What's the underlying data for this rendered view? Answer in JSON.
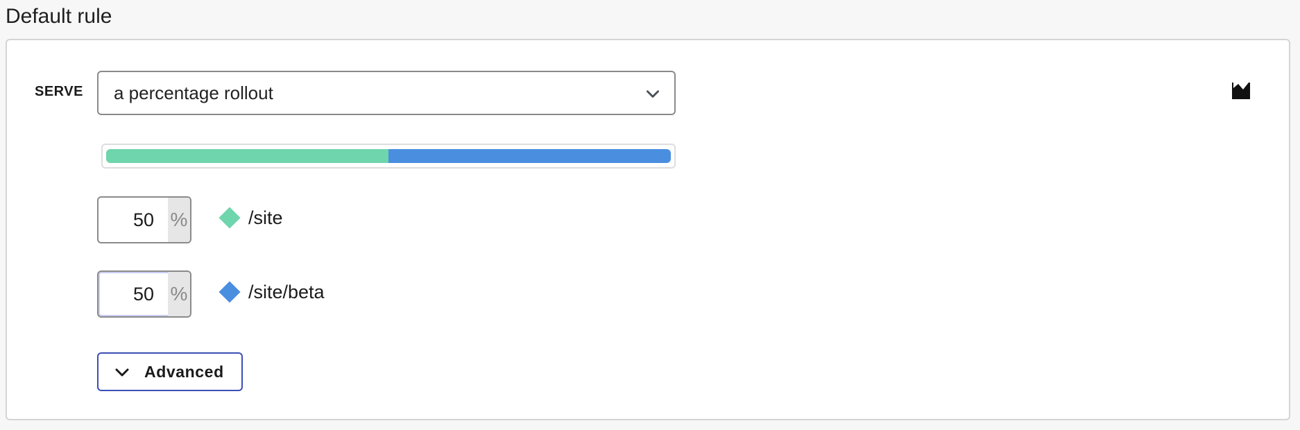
{
  "section": {
    "title": "Default rule"
  },
  "serve": {
    "label": "SERVE",
    "selected": "a percentage rollout"
  },
  "insights_icon": "area-chart-icon",
  "rollout": {
    "variations": [
      {
        "percent": "50",
        "suffix": "%",
        "name": "/site",
        "color": "#6fd5ac"
      },
      {
        "percent": "50",
        "suffix": "%",
        "name": "/site/beta",
        "color": "#4a8ee0"
      }
    ]
  },
  "advanced": {
    "label": "Advanced"
  }
}
